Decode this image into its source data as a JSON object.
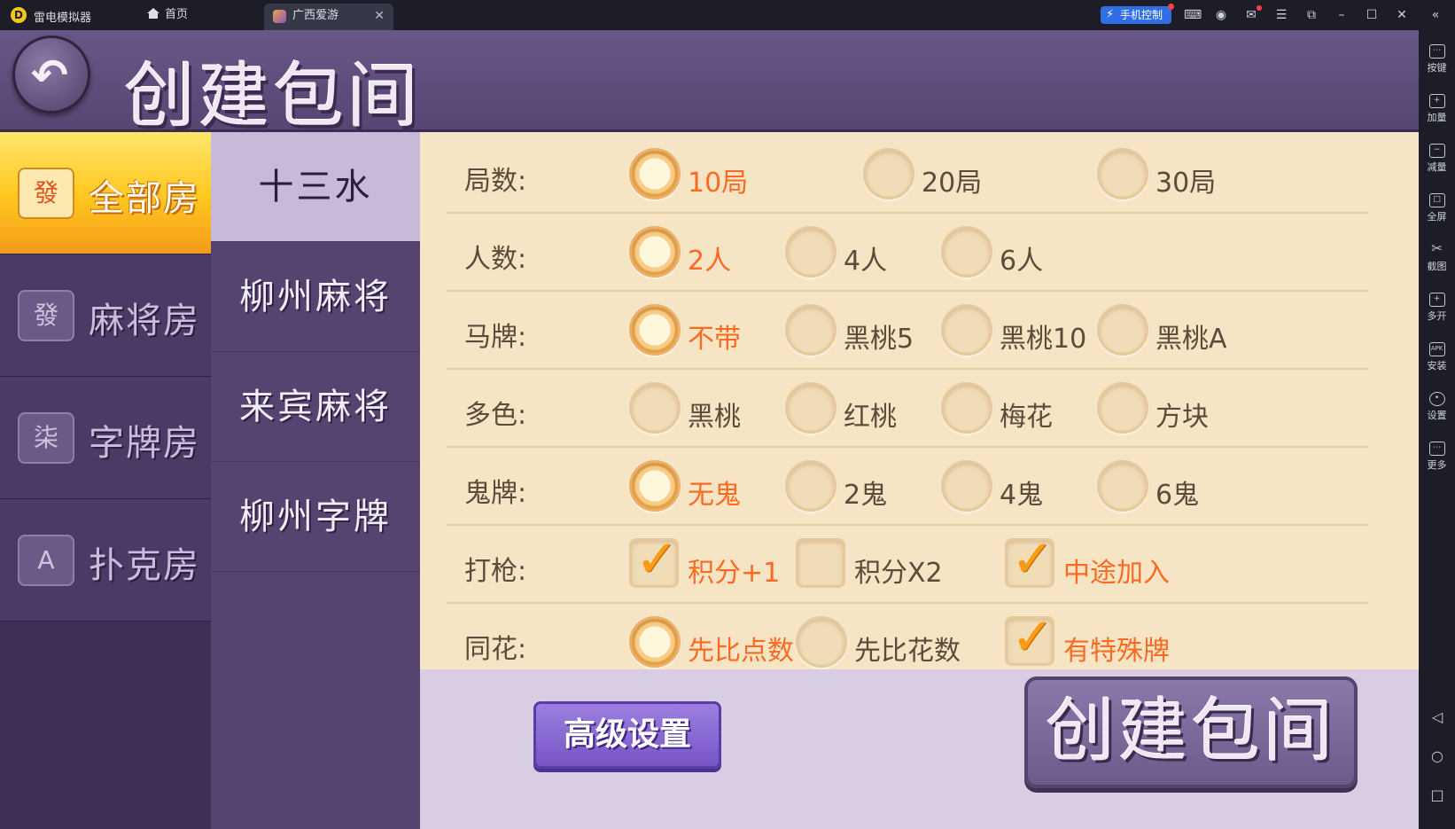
{
  "titlebar": {
    "app_name": "雷电模拟器",
    "home_tab": "首页",
    "active_tab": "广西爱游",
    "phone_control": "手机控制"
  },
  "rightbar": {
    "items": [
      {
        "icon": "keyboard-icon",
        "label": "按键"
      },
      {
        "icon": "volume-up-icon",
        "label": "加量"
      },
      {
        "icon": "volume-down-icon",
        "label": "减量"
      },
      {
        "icon": "fullscreen-icon",
        "label": "全屏"
      },
      {
        "icon": "scissors-icon",
        "label": "截图"
      },
      {
        "icon": "multi-open-icon",
        "label": "多开"
      },
      {
        "icon": "apk-icon",
        "label": "安装"
      },
      {
        "icon": "gear-icon",
        "label": "设置"
      },
      {
        "icon": "more-icon",
        "label": "更多"
      }
    ]
  },
  "header": {
    "title": "创建包间"
  },
  "categories": [
    {
      "label": "全部房",
      "icon_text": "發",
      "active": true
    },
    {
      "label": "麻将房",
      "icon_text": "發",
      "active": false
    },
    {
      "label": "字牌房",
      "icon_text": "柒",
      "active": false
    },
    {
      "label": "扑克房",
      "icon_text": "A",
      "active": false
    }
  ],
  "games": [
    {
      "label": "十三水",
      "active": true
    },
    {
      "label": "柳州麻将",
      "active": false
    },
    {
      "label": "来宾麻将",
      "active": false
    },
    {
      "label": "柳州字牌",
      "active": false
    }
  ],
  "options": {
    "rounds": {
      "label": "局数:",
      "choices": [
        "10局",
        "20局",
        "30局"
      ],
      "selected": "10局"
    },
    "players": {
      "label": "人数:",
      "choices": [
        "2人",
        "4人",
        "6人"
      ],
      "selected": "2人"
    },
    "horse": {
      "label": "马牌:",
      "choices": [
        "不带",
        "黑桃5",
        "黑桃10",
        "黑桃A"
      ],
      "selected": "不带"
    },
    "colors": {
      "label": "多色:",
      "choices": [
        "黑桃",
        "红桃",
        "梅花",
        "方块"
      ],
      "selected": ""
    },
    "ghost": {
      "label": "鬼牌:",
      "choices": [
        "无鬼",
        "2鬼",
        "4鬼",
        "6鬼"
      ],
      "selected": "无鬼"
    },
    "gun": {
      "label": "打枪:",
      "choices": [
        "积分+1",
        "积分X2",
        "中途加入"
      ],
      "checked": [
        "积分+1",
        "中途加入"
      ]
    },
    "flush": {
      "label": "同花:",
      "choices": [
        "先比点数",
        "先比花数",
        "有特殊牌"
      ],
      "selected": "先比点数",
      "checked": [
        "有特殊牌"
      ]
    }
  },
  "buttons": {
    "advanced": "高级设置",
    "create": "创建包间"
  },
  "colors": {
    "selected_text": "#fb6a22",
    "panel_bg": "#f6e5c5",
    "active_category": "#ffc61e"
  }
}
